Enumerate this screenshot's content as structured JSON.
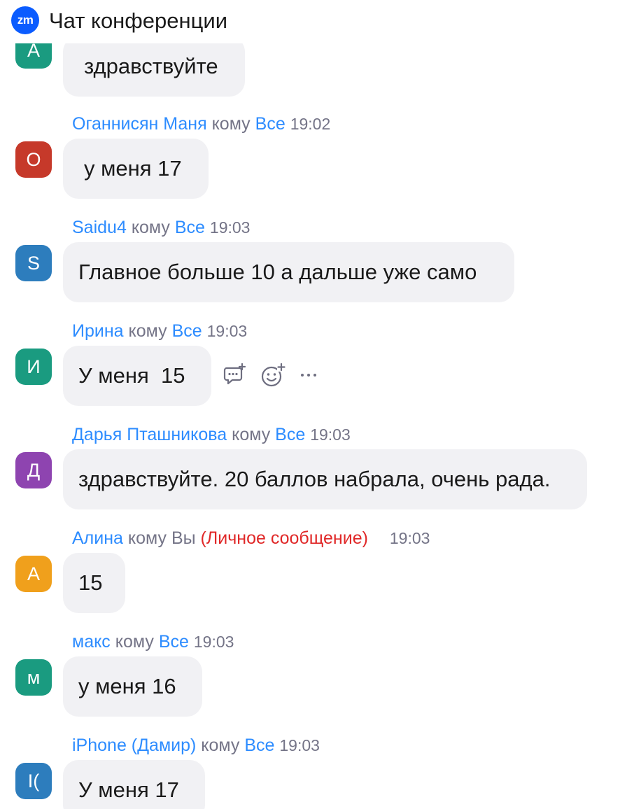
{
  "window": {
    "title": "Чат конференции",
    "logo_text": "zm"
  },
  "colors": {
    "accent": "#2d8cff",
    "private": "#e02828",
    "bubble": "#f1f1f4",
    "avatar_teal": "#1a9b80",
    "avatar_red": "#c6392a",
    "avatar_blue": "#2d7dbd",
    "avatar_purple": "#8e44b0",
    "avatar_orange": "#f0a01c"
  },
  "messages": [
    {
      "avatar": "A",
      "text": "здравствуйте"
    },
    {
      "avatar": "O",
      "sender": "Оганнисян Маня",
      "to_word": "кому",
      "recipient": "Все",
      "time": "19:02",
      "text": "у меня 17"
    },
    {
      "avatar": "S",
      "sender": "Saidu4",
      "to_word": "кому",
      "recipient": "Все",
      "time": "19:03",
      "text": "Главное больше 10 а дальше уже само"
    },
    {
      "avatar": "И",
      "sender": "Ирина",
      "to_word": "кому",
      "recipient": "Все",
      "time": "19:03",
      "text": "У меня  15"
    },
    {
      "avatar": "Д",
      "sender": "Дарья Пташникова",
      "to_word": "кому",
      "recipient": "Все",
      "time": "19:03",
      "text": "здравствуйте. 20 баллов набрала, очень рада."
    },
    {
      "avatar": "A",
      "sender": "Алина",
      "to_word": "кому",
      "recipient": "Вы",
      "private_label": "(Личное сообщение)",
      "time": "19:03",
      "text": "15"
    },
    {
      "avatar": "м",
      "sender": "макс",
      "to_word": "кому",
      "recipient": "Все",
      "time": "19:03",
      "text": "у меня 16"
    },
    {
      "avatar": "I(",
      "sender": "iPhone (Дамир)",
      "to_word": "кому",
      "recipient": "Все",
      "time": "19:03",
      "text": "У меня 17"
    }
  ],
  "hover_actions": [
    "reply-icon",
    "add-reaction-icon",
    "more-icon"
  ]
}
